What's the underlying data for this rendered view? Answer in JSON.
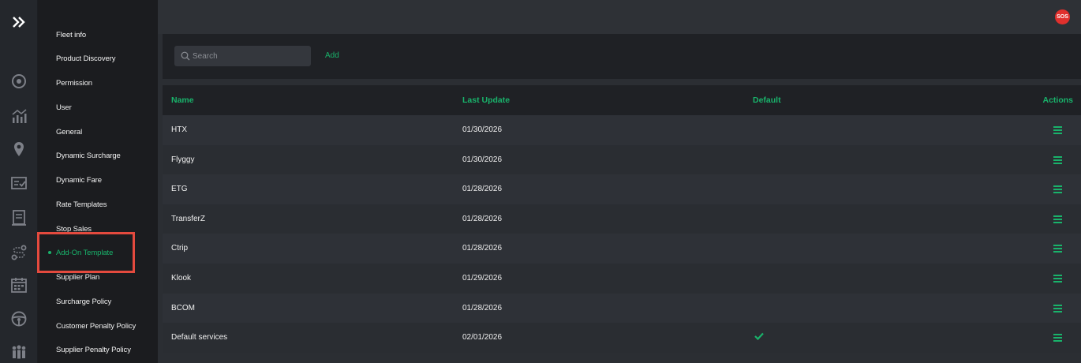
{
  "sidebar": {
    "items": [
      {
        "label": "Fleet info"
      },
      {
        "label": "Product Discovery"
      },
      {
        "label": "Permission"
      },
      {
        "label": "User"
      },
      {
        "label": "General"
      },
      {
        "label": "Dynamic Surcharge"
      },
      {
        "label": "Dynamic Fare"
      },
      {
        "label": "Rate Templates"
      },
      {
        "label": "Stop Sales"
      },
      {
        "label": "Add-On Template",
        "active": true
      },
      {
        "label": "Supplier Plan"
      },
      {
        "label": "Surcharge Policy"
      },
      {
        "label": "Customer Penalty Policy"
      },
      {
        "label": "Supplier Penalty Policy"
      }
    ]
  },
  "rail": {
    "icons": [
      "expand-icon",
      "target-icon",
      "analytics-icon",
      "location-pin-icon",
      "checklist-icon",
      "document-icon",
      "route-icon",
      "calendar-icon",
      "steering-wheel-icon",
      "people-icon"
    ]
  },
  "header": {
    "sos_label": "SOS"
  },
  "toolbar": {
    "search_placeholder": "Search",
    "add_label": "Add"
  },
  "table": {
    "columns": [
      "Name",
      "Last Update",
      "Default",
      "Actions"
    ],
    "rows": [
      {
        "name": "HTX",
        "last_update": "01/30/2026",
        "default": false
      },
      {
        "name": "Flyggy",
        "last_update": "01/30/2026",
        "default": false
      },
      {
        "name": "ETG",
        "last_update": "01/28/2026",
        "default": false
      },
      {
        "name": "TransferZ",
        "last_update": "01/28/2026",
        "default": false
      },
      {
        "name": "Ctrip",
        "last_update": "01/28/2026",
        "default": false
      },
      {
        "name": "Klook",
        "last_update": "01/29/2026",
        "default": false
      },
      {
        "name": "BCOM",
        "last_update": "01/28/2026",
        "default": false
      },
      {
        "name": "Default services",
        "last_update": "02/01/2026",
        "default": true
      }
    ]
  },
  "colors": {
    "accent": "#19b36b",
    "highlight": "#e44a3e",
    "sos": "#e0302d"
  }
}
